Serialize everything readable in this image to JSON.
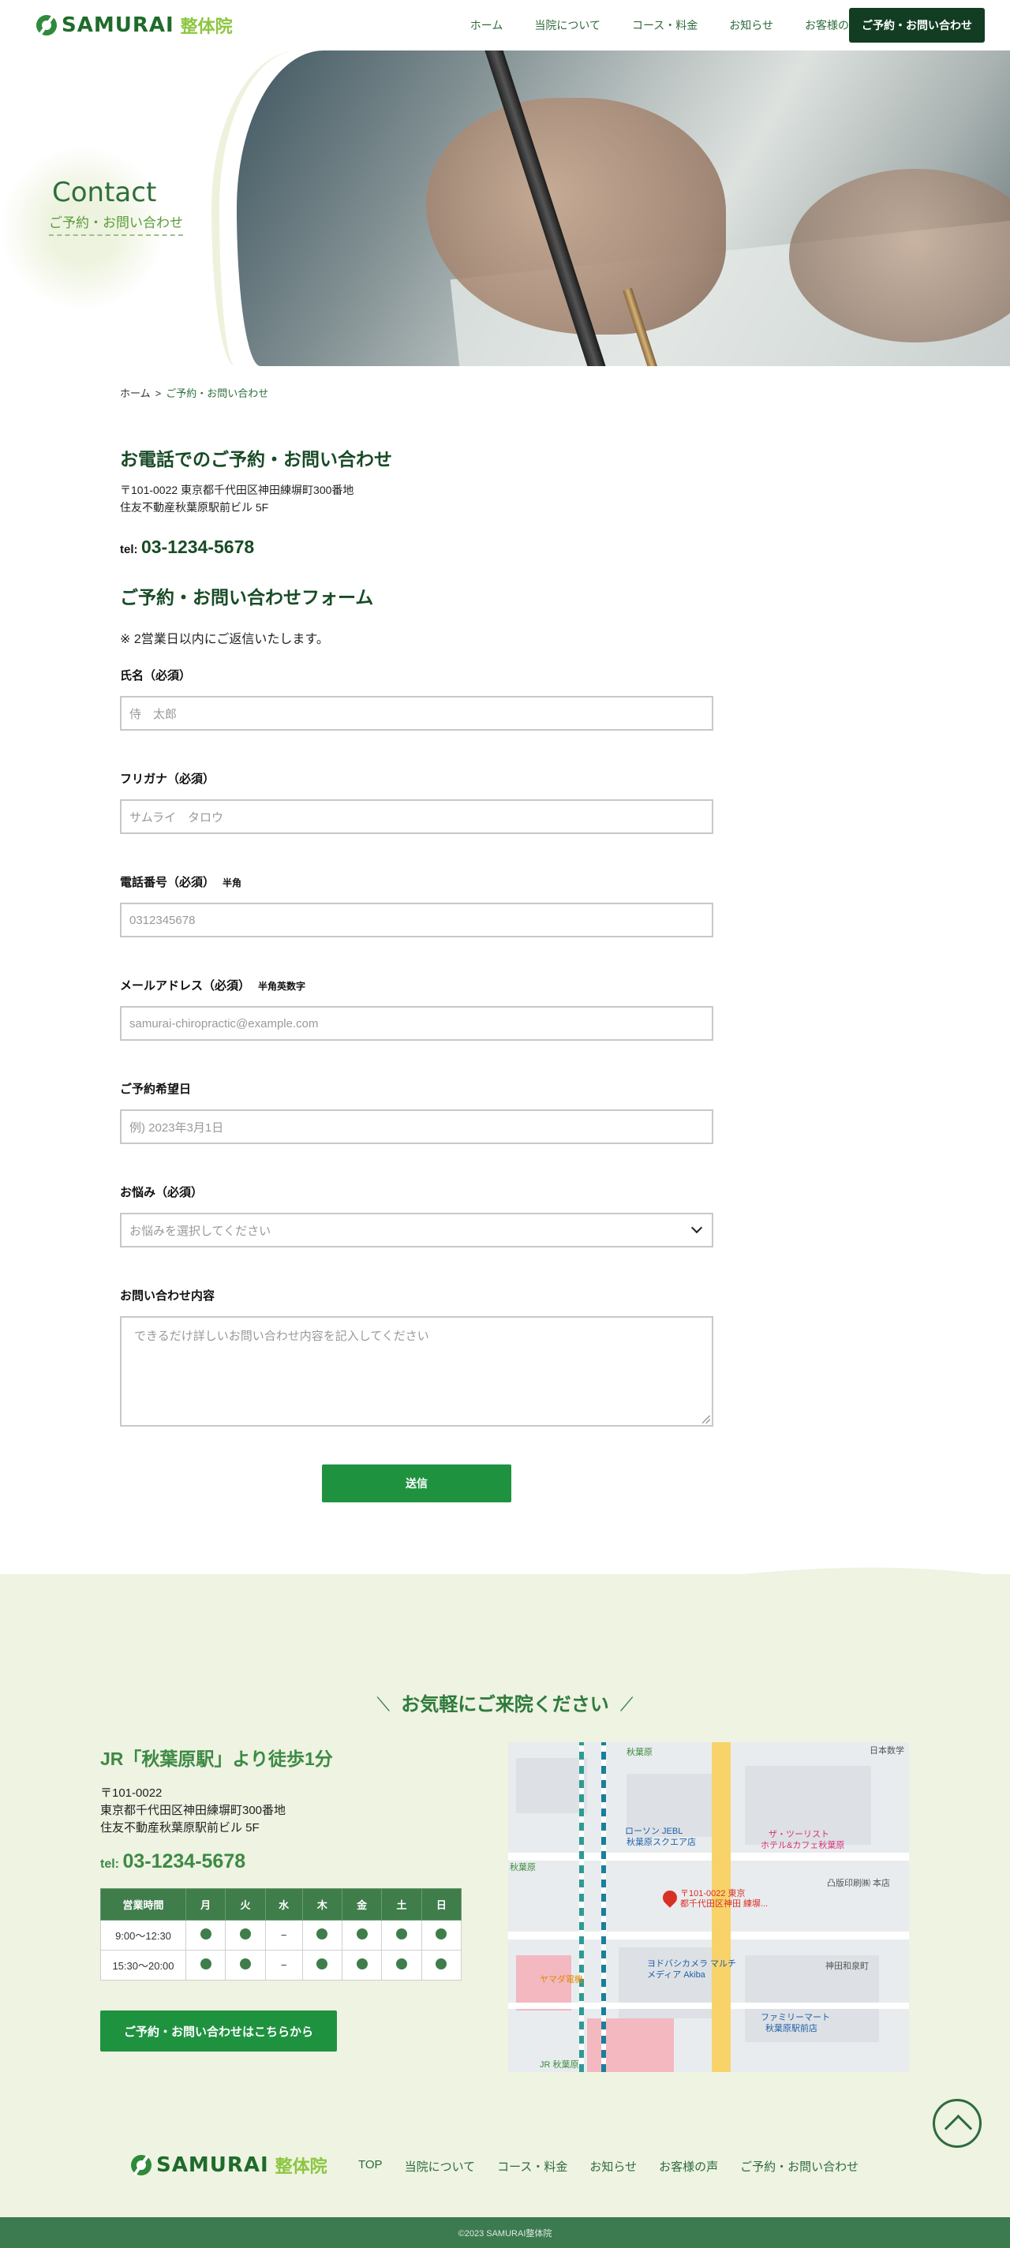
{
  "header": {
    "logo_text": "SAMURAI",
    "logo_sub": "整体院",
    "nav": [
      "ホーム",
      "当院について",
      "コース・料金",
      "お知らせ",
      "お客様の声"
    ],
    "cta": "ご予約・お問い合わせ"
  },
  "hero": {
    "title": "Contact",
    "subtitle": "ご予約・お問い合わせ"
  },
  "breadcrumb": {
    "home": "ホーム",
    "sep": ">",
    "current": "ご予約・お問い合わせ"
  },
  "phone_section": {
    "heading": "お電話でのご予約・お問い合わせ",
    "address1": "〒101-0022 東京都千代田区神田練塀町300番地",
    "address2": "住友不動産秋葉原駅前ビル 5F",
    "tel_label": "tel:",
    "tel_number": "03-1234-5678"
  },
  "form": {
    "heading": "ご予約・お問い合わせフォーム",
    "note": "※ 2営業日以内にご返信いたします。",
    "name_label": "氏名（必須）",
    "name_placeholder": "侍　太郎",
    "kana_label": "フリガナ（必須）",
    "kana_placeholder": "サムライ　タロウ",
    "phone_label": "電話番号（必須）",
    "phone_hint": "半角",
    "phone_placeholder": "0312345678",
    "email_label": "メールアドレス（必須）",
    "email_hint": "半角英数字",
    "email_placeholder": "samurai-chiropractic@example.com",
    "date_label": "ご予約希望日",
    "date_placeholder": "例) 2023年3月1日",
    "concern_label": "お悩み（必須）",
    "concern_placeholder": "お悩みを選択してください",
    "message_label": "お問い合わせ内容",
    "message_placeholder": "できるだけ詳しいお問い合わせ内容を記入してください",
    "submit": "送信"
  },
  "access": {
    "welcome": "お気軽にご来院ください",
    "title": "JR「秋葉原駅」より徒歩1分",
    "postal": "〒101-0022",
    "address1": "東京都千代田区神田練塀町300番地",
    "address2": "住友不動産秋葉原駅前ビル 5F",
    "tel_label": "tel:",
    "tel_number": "03-1234-5678",
    "hours": {
      "header": [
        "営業時間",
        "月",
        "火",
        "水",
        "木",
        "金",
        "土",
        "日"
      ],
      "rows": [
        {
          "time": "9:00〜12:30",
          "days": [
            "●",
            "●",
            "−",
            "●",
            "●",
            "●",
            "●"
          ]
        },
        {
          "time": "15:30〜20:00",
          "days": [
            "●",
            "●",
            "−",
            "●",
            "●",
            "●",
            "●"
          ]
        }
      ]
    },
    "cta": "ご予約・お問い合わせはこちらから",
    "map": {
      "pin_line1": "〒101-0022 東京",
      "pin_line2": "都千代田区神田 練塀...",
      "labels": [
        "秋葉原",
        "ローソン JEBL",
        "秋葉原スクエア店",
        "ザ・ツーリスト",
        "ホテル&カフェ秋葉原",
        "ヨドバシカメラ マルチ",
        "メディア Akiba",
        "ファミリーマート",
        "秋葉原駅前店",
        "神田和泉町",
        "凸版印刷㈱ 本店",
        "秋葉原",
        "JR 秋葉原",
        "ヤマダ電機",
        "日本数学"
      ]
    }
  },
  "footer": {
    "nav": [
      "TOP",
      "当院について",
      "コース・料金",
      "お知らせ",
      "お客様の声",
      "ご予約・お問い合わせ"
    ],
    "copyright": "©2023 SAMURAI整体院"
  },
  "colors": {
    "primary_dark": "#123d22",
    "primary": "#1f9240",
    "accent_lime": "#8cc63f",
    "bg_green": "#eef3e2"
  }
}
